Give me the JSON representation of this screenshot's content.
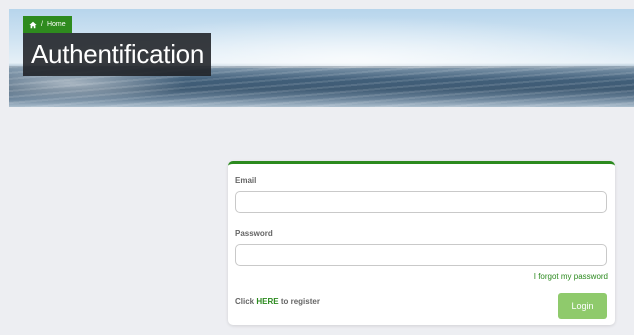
{
  "header": {
    "breadcrumb": {
      "home_label": "Home",
      "separator": "/"
    },
    "title": "Authentification"
  },
  "login_form": {
    "email_label": "Email",
    "email_value": "",
    "password_label": "Password",
    "password_value": "",
    "forgot_password_link": "I forgot my password",
    "register_prefix": "Click",
    "register_link": "HERE",
    "register_suffix": "to register",
    "login_button": "Login"
  },
  "colors": {
    "accent_green": "#2b8a1e",
    "button_green": "#8fca6c",
    "page_background": "#edeef2"
  },
  "icons": {
    "breadcrumb_home": "home-icon"
  }
}
